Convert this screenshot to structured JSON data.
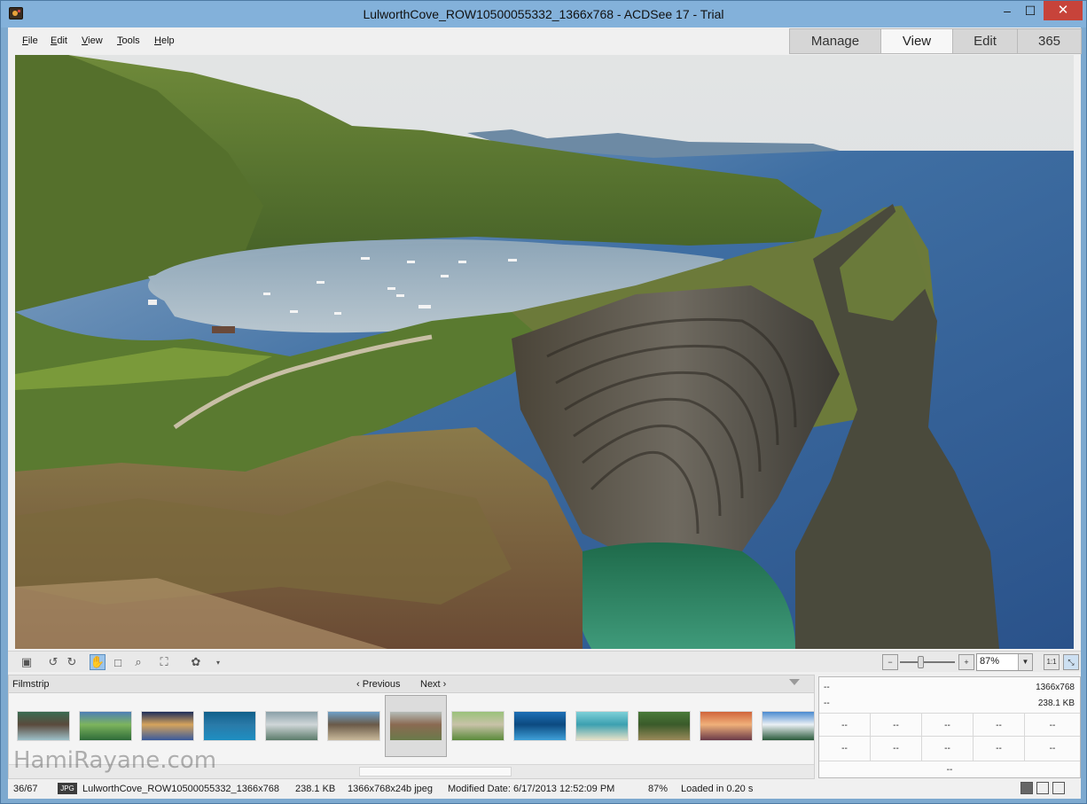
{
  "window": {
    "title": "LulworthCove_ROW10500055332_1366x768 - ACDSee 17 - Trial",
    "minimize": "–",
    "maximize": "☐",
    "close": "✕"
  },
  "menu": [
    {
      "label": "File",
      "key": "F",
      "rest": "ile"
    },
    {
      "label": "Edit",
      "key": "E",
      "rest": "dit"
    },
    {
      "label": "View",
      "key": "V",
      "rest": "iew"
    },
    {
      "label": "Tools",
      "key": "T",
      "rest": "ools"
    },
    {
      "label": "Help",
      "key": "H",
      "rest": "elp"
    }
  ],
  "mode_tabs": [
    "Manage",
    "View",
    "Edit",
    "365"
  ],
  "active_mode": "View",
  "toolbar": {
    "zoom_value": "87%",
    "zoom_level": 0.37,
    "actual_size_label": "1:1"
  },
  "filmstrip": {
    "title": "Filmstrip",
    "previous": "Previous",
    "next": "Next",
    "selected_index": 6,
    "thumbs": [
      {
        "name": "waterfall",
        "colors": [
          "#3b6b52",
          "#9ec1c9",
          "#5a4a3c"
        ]
      },
      {
        "name": "alpine-lake",
        "colors": [
          "#4e7fb6",
          "#2e6b39",
          "#7db45d"
        ]
      },
      {
        "name": "night-sky",
        "colors": [
          "#1d2d5a",
          "#3a5a9c",
          "#d6a45c"
        ]
      },
      {
        "name": "underwater",
        "colors": [
          "#0f5f8a",
          "#1e8fc2",
          "#2a7aa8"
        ]
      },
      {
        "name": "misty-mountains",
        "colors": [
          "#8aa0a8",
          "#5b7b6a",
          "#cfd6d8"
        ]
      },
      {
        "name": "coast-rocks",
        "colors": [
          "#6ea0c8",
          "#c8b89a",
          "#6a5a48"
        ]
      },
      {
        "name": "lulworth-cove",
        "colors": [
          "#b5bdb8",
          "#6a7a4a",
          "#8a6a52"
        ]
      },
      {
        "name": "green-terraces",
        "colors": [
          "#9ac27a",
          "#5a8a3a",
          "#c8c2a8"
        ]
      },
      {
        "name": "blue-lagoon",
        "colors": [
          "#1e6fb6",
          "#3fa0d8",
          "#0c4a80"
        ]
      },
      {
        "name": "tropical-beach",
        "colors": [
          "#7ed0d8",
          "#e8e2c8",
          "#3ca0b0"
        ]
      },
      {
        "name": "rocky-island",
        "colors": [
          "#4a7a3a",
          "#9a8a5a",
          "#3a5a2a"
        ]
      },
      {
        "name": "sunset-shore",
        "colors": [
          "#d0643a",
          "#6a3a48",
          "#f0b07a"
        ]
      },
      {
        "name": "mountain-lake",
        "colors": [
          "#4a8ad0",
          "#2a5a3a",
          "#eaf0f4"
        ]
      }
    ]
  },
  "info_panel": {
    "row1_left": "--",
    "row1_right": "1366x768",
    "row2_left": "--",
    "row2_right": "238.1 KB",
    "grid1": [
      "--",
      "--",
      "--",
      "--",
      "--"
    ],
    "grid2": [
      "--",
      "--",
      "--",
      "--",
      "--"
    ],
    "bottom": "--"
  },
  "status": {
    "position": "36/67",
    "format_badge": "JPG",
    "filename": "LulworthCove_ROW10500055332_1366x768",
    "filesize": "238.1 KB",
    "dimensions": "1366x768x24b jpeg",
    "modified": "Modified Date: 6/17/2013 12:52:09 PM",
    "zoom": "87%",
    "load_time": "Loaded in 0.20 s"
  },
  "watermark": "HamiRayane.com"
}
